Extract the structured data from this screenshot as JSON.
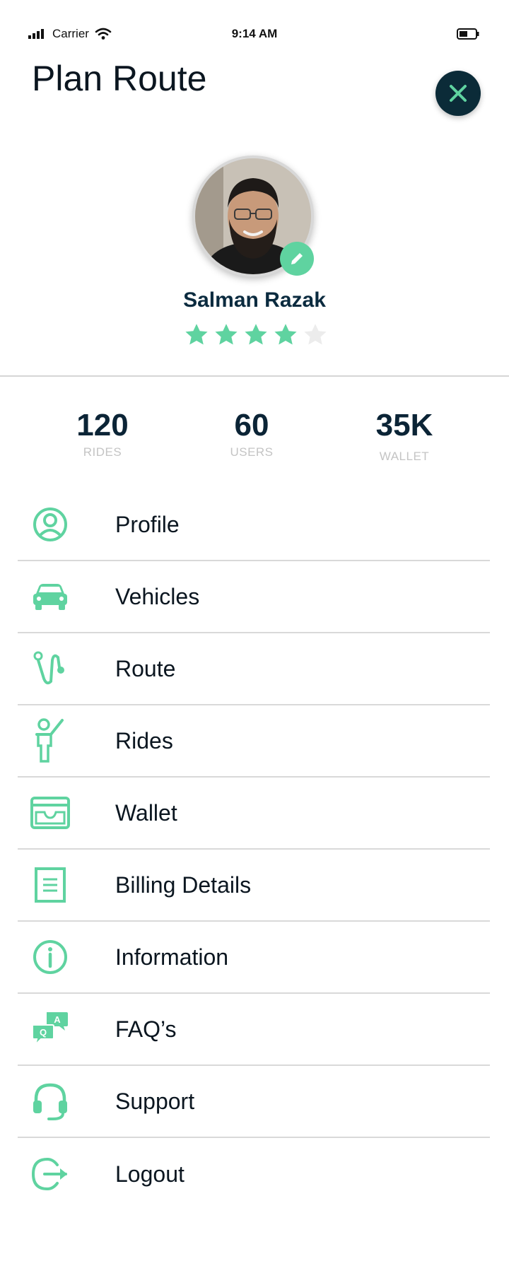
{
  "status_bar": {
    "carrier": "Carrier",
    "time": "9:14 AM"
  },
  "page_title": "Plan Route",
  "profile": {
    "name": "Salman Razak",
    "rating": 4,
    "rating_max": 5
  },
  "stats": [
    {
      "value": "120",
      "label": "RIDES"
    },
    {
      "value": "60",
      "label": "USERS"
    },
    {
      "value": "35K",
      "label": "WALLET"
    }
  ],
  "menu": [
    {
      "label": "Profile",
      "icon": "profile-icon"
    },
    {
      "label": "Vehicles",
      "icon": "car-icon"
    },
    {
      "label": "Route",
      "icon": "route-icon"
    },
    {
      "label": "Rides",
      "icon": "rider-icon"
    },
    {
      "label": "Wallet",
      "icon": "wallet-icon"
    },
    {
      "label": "Billing Details",
      "icon": "billing-document-icon"
    },
    {
      "label": "Information",
      "icon": "info-icon"
    },
    {
      "label": "FAQ’s",
      "icon": "faq-icon"
    },
    {
      "label": "Support",
      "icon": "headset-icon"
    },
    {
      "label": "Logout",
      "icon": "logout-icon"
    }
  ],
  "colors": {
    "accent": "#5fd3a0",
    "dark": "#0b2b38",
    "star_empty": "#ececec"
  }
}
